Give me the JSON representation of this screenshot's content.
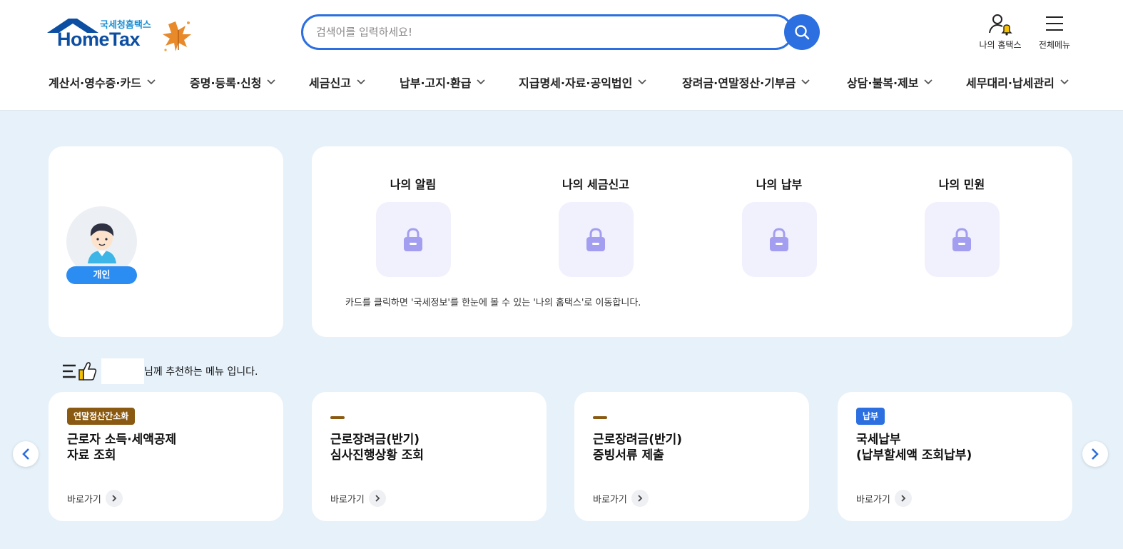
{
  "header": {
    "logo_sub": "국세청홈택스",
    "logo_main": "HomeTax",
    "search_placeholder": "검색어를 입력하세요!",
    "my_hometax": "나의 홈택스",
    "all_menu": "전체메뉴"
  },
  "nav": [
    {
      "label": "계산서·영수증·카드"
    },
    {
      "label": "증명·등록·신청"
    },
    {
      "label": "세금신고"
    },
    {
      "label": "납부·고지·환급"
    },
    {
      "label": "지급명세·자료·공익법인"
    },
    {
      "label": "장려금·연말정산·기부금"
    },
    {
      "label": "상담·불복·제보"
    },
    {
      "label": "세무대리·납세관리"
    }
  ],
  "profile": {
    "badge": "개인"
  },
  "my": {
    "items": [
      {
        "title": "나의 알림"
      },
      {
        "title": "나의 세금신고"
      },
      {
        "title": "나의 납부"
      },
      {
        "title": "나의 민원"
      }
    ],
    "note": "카드를 클릭하면 '국세정보'를 한눈에 볼 수 있는 '나의 홈택스'로 이동합니다."
  },
  "recommend": {
    "text": "님께 추천하는 메뉴 입니다.",
    "go_label": "바로가기",
    "cards": [
      {
        "tag": "연말정산간소화",
        "tag_color": "#8a5a12",
        "line1": "근로자 소득·세액공제",
        "line2": "자료 조회"
      },
      {
        "tag": "",
        "tag_color": "",
        "line1": "근로장려금(반기)",
        "line2": "심사진행상황 조회"
      },
      {
        "tag": "",
        "tag_color": "",
        "line1": "근로장려금(반기)",
        "line2": "증빙서류 제출"
      },
      {
        "tag": "납부",
        "tag_color": "#2b6fe0",
        "line1": "국세납부",
        "line2": "(납부할세액 조회납부)"
      }
    ]
  },
  "colors": {
    "accent": "#2b6fe0",
    "background": "#e6f1fa",
    "lock": "#a49ef0"
  }
}
